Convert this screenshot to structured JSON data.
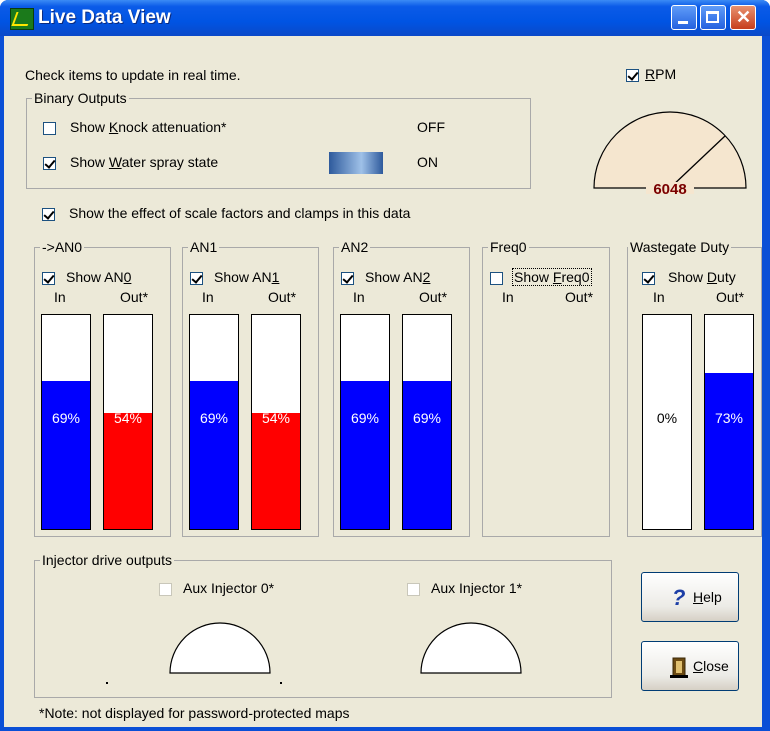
{
  "window": {
    "title": "Live Data View"
  },
  "header": {
    "instructions": "Check items to update in real time."
  },
  "rpm": {
    "label_pre": "",
    "label_u": "R",
    "label_post": "PM",
    "checked": true,
    "value": "6048"
  },
  "binary_outputs": {
    "title": "Binary Outputs",
    "knock": {
      "pre": "Show ",
      "u": "K",
      "post": "nock attenuation*",
      "state": "OFF",
      "checked": false
    },
    "water": {
      "pre": "Show ",
      "u": "W",
      "post": "ater spray state",
      "state": "ON",
      "checked": true
    }
  },
  "scale": {
    "label": "Show the effect of scale factors and clamps in this data",
    "checked": true
  },
  "channels": [
    {
      "title": "->AN0",
      "show_pre": "Show AN",
      "show_u": "0",
      "in_label": "In",
      "out_label": "Out*",
      "checked": true,
      "in": {
        "value": 69,
        "text": "69%",
        "color": "#0000ff"
      },
      "out": {
        "value": 54,
        "text": "54%",
        "color": "#ff0000"
      }
    },
    {
      "title": "AN1",
      "show_pre": "Show AN",
      "show_u": "1",
      "in_label": "In",
      "out_label": "Out*",
      "checked": true,
      "in": {
        "value": 69,
        "text": "69%",
        "color": "#0000ff"
      },
      "out": {
        "value": 54,
        "text": "54%",
        "color": "#ff0000"
      }
    },
    {
      "title": "AN2",
      "show_pre": "Show AN",
      "show_u": "2",
      "in_label": "In",
      "out_label": "Out*",
      "checked": true,
      "in": {
        "value": 69,
        "text": "69%",
        "color": "#0000ff"
      },
      "out": {
        "value": 69,
        "text": "69%",
        "color": "#0000ff"
      }
    },
    {
      "title": "Freq0",
      "show_pre": "Show ",
      "show_u": "F",
      "show_post": "req0",
      "in_label": "In",
      "out_label": "Out*",
      "checked": false
    },
    {
      "title": "Wastegate Duty",
      "show_pre": "Show ",
      "show_u": "D",
      "show_post": "uty",
      "in_label": "In",
      "out_label": "Out*",
      "checked": true,
      "in": {
        "value": 0,
        "text": "0%",
        "color": "#0000ff"
      },
      "out": {
        "value": 73,
        "text": "73%",
        "color": "#0000ff"
      }
    }
  ],
  "injectors": {
    "title": "Injector drive outputs",
    "aux0": {
      "label": "Aux Injector 0*",
      "checked": false
    },
    "aux1": {
      "label": "Aux Injector 1*",
      "checked": false
    }
  },
  "buttons": {
    "help_u": "H",
    "help_post": "elp",
    "close_u": "C",
    "close_post": "lose"
  },
  "note": "*Note: not displayed for password-protected maps",
  "colors": {
    "title_blue": "#0054e3",
    "face": "#ece9d8",
    "bar_blue": "#0000ff",
    "bar_red": "#ff0000",
    "gauge_fill": "#f5e6cf",
    "rpm_text": "#7a0000"
  }
}
